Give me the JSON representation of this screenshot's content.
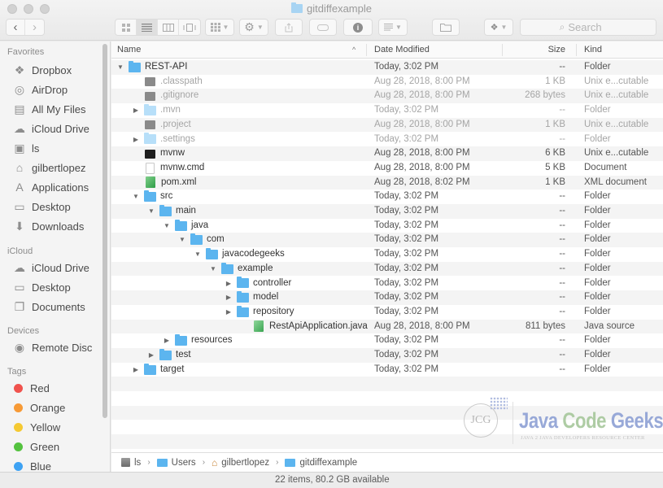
{
  "window": {
    "title": "gitdiffexample"
  },
  "toolbar": {
    "back_icon": "chevron-left-icon",
    "forward_icon": "chevron-right-icon",
    "view_modes": [
      "icon-view",
      "list-view",
      "column-view",
      "cover-flow-view"
    ],
    "active_view": "list-view",
    "search_placeholder": "Search"
  },
  "sidebar": {
    "sections": [
      {
        "heading": "Favorites",
        "items": [
          {
            "label": "Dropbox",
            "icon": "dropbox-icon"
          },
          {
            "label": "AirDrop",
            "icon": "airdrop-icon"
          },
          {
            "label": "All My Files",
            "icon": "all-files-icon"
          },
          {
            "label": "iCloud Drive",
            "icon": "cloud-icon"
          },
          {
            "label": "ls",
            "icon": "disk-icon"
          },
          {
            "label": "gilbertlopez",
            "icon": "home-icon"
          },
          {
            "label": "Applications",
            "icon": "applications-icon"
          },
          {
            "label": "Desktop",
            "icon": "desktop-icon"
          },
          {
            "label": "Downloads",
            "icon": "downloads-icon"
          }
        ]
      },
      {
        "heading": "iCloud",
        "items": [
          {
            "label": "iCloud Drive",
            "icon": "cloud-icon"
          },
          {
            "label": "Desktop",
            "icon": "desktop-icon"
          },
          {
            "label": "Documents",
            "icon": "documents-icon"
          }
        ]
      },
      {
        "heading": "Devices",
        "items": [
          {
            "label": "Remote Disc",
            "icon": "disc-icon"
          }
        ]
      },
      {
        "heading": "Tags",
        "items": [
          {
            "label": "Red",
            "color": "#f0524d"
          },
          {
            "label": "Orange",
            "color": "#f79a36"
          },
          {
            "label": "Yellow",
            "color": "#f5c932"
          },
          {
            "label": "Green",
            "color": "#54c23f"
          },
          {
            "label": "Blue",
            "color": "#3ea2f3"
          }
        ]
      }
    ]
  },
  "columns": {
    "name": "Name",
    "date": "Date Modified",
    "size": "Size",
    "kind": "Kind",
    "sort_indicator": "^"
  },
  "files": [
    {
      "name": "REST-API",
      "depth": 0,
      "disclosure": "expanded",
      "icon": "folder",
      "date": "Today, 3:02 PM",
      "size": "--",
      "kind": "Folder",
      "dim": false
    },
    {
      "name": ".classpath",
      "depth": 1,
      "disclosure": "none",
      "icon": "exec",
      "date": "Aug 28, 2018, 8:00 PM",
      "size": "1 KB",
      "kind": "Unix e...cutable",
      "dim": true
    },
    {
      "name": ".gitignore",
      "depth": 1,
      "disclosure": "none",
      "icon": "exec",
      "date": "Aug 28, 2018, 8:00 PM",
      "size": "268 bytes",
      "kind": "Unix e...cutable",
      "dim": true
    },
    {
      "name": ".mvn",
      "depth": 1,
      "disclosure": "collapsed",
      "icon": "folder-light",
      "date": "Today, 3:02 PM",
      "size": "--",
      "kind": "Folder",
      "dim": true
    },
    {
      "name": ".project",
      "depth": 1,
      "disclosure": "none",
      "icon": "exec",
      "date": "Aug 28, 2018, 8:00 PM",
      "size": "1 KB",
      "kind": "Unix e...cutable",
      "dim": true
    },
    {
      "name": ".settings",
      "depth": 1,
      "disclosure": "collapsed",
      "icon": "folder-light",
      "date": "Today, 3:02 PM",
      "size": "--",
      "kind": "Folder",
      "dim": true
    },
    {
      "name": "mvnw",
      "depth": 1,
      "disclosure": "none",
      "icon": "term",
      "date": "Aug 28, 2018, 8:00 PM",
      "size": "6 KB",
      "kind": "Unix e...cutable",
      "dim": false
    },
    {
      "name": "mvnw.cmd",
      "depth": 1,
      "disclosure": "none",
      "icon": "doc",
      "date": "Aug 28, 2018, 8:00 PM",
      "size": "5 KB",
      "kind": "Document",
      "dim": false
    },
    {
      "name": "pom.xml",
      "depth": 1,
      "disclosure": "none",
      "icon": "xml",
      "date": "Aug 28, 2018, 8:02 PM",
      "size": "1 KB",
      "kind": "XML document",
      "dim": false
    },
    {
      "name": "src",
      "depth": 1,
      "disclosure": "expanded",
      "icon": "folder",
      "date": "Today, 3:02 PM",
      "size": "--",
      "kind": "Folder",
      "dim": false
    },
    {
      "name": "main",
      "depth": 2,
      "disclosure": "expanded",
      "icon": "folder",
      "date": "Today, 3:02 PM",
      "size": "--",
      "kind": "Folder",
      "dim": false
    },
    {
      "name": "java",
      "depth": 3,
      "disclosure": "expanded",
      "icon": "folder",
      "date": "Today, 3:02 PM",
      "size": "--",
      "kind": "Folder",
      "dim": false
    },
    {
      "name": "com",
      "depth": 4,
      "disclosure": "expanded",
      "icon": "folder",
      "date": "Today, 3:02 PM",
      "size": "--",
      "kind": "Folder",
      "dim": false
    },
    {
      "name": "javacodegeeks",
      "depth": 5,
      "disclosure": "expanded",
      "icon": "folder",
      "date": "Today, 3:02 PM",
      "size": "--",
      "kind": "Folder",
      "dim": false
    },
    {
      "name": "example",
      "depth": 6,
      "disclosure": "expanded",
      "icon": "folder",
      "date": "Today, 3:02 PM",
      "size": "--",
      "kind": "Folder",
      "dim": false
    },
    {
      "name": "controller",
      "depth": 7,
      "disclosure": "collapsed",
      "icon": "folder",
      "date": "Today, 3:02 PM",
      "size": "--",
      "kind": "Folder",
      "dim": false
    },
    {
      "name": "model",
      "depth": 7,
      "disclosure": "collapsed",
      "icon": "folder",
      "date": "Today, 3:02 PM",
      "size": "--",
      "kind": "Folder",
      "dim": false
    },
    {
      "name": "repository",
      "depth": 7,
      "disclosure": "collapsed",
      "icon": "folder",
      "date": "Today, 3:02 PM",
      "size": "--",
      "kind": "Folder",
      "dim": false
    },
    {
      "name": "RestApiApplication.java",
      "depth": 8,
      "disclosure": "none",
      "icon": "java",
      "date": "Aug 28, 2018, 8:00 PM",
      "size": "811 bytes",
      "kind": "Java source",
      "dim": false
    },
    {
      "name": "resources",
      "depth": 3,
      "disclosure": "collapsed",
      "icon": "folder",
      "date": "Today, 3:02 PM",
      "size": "--",
      "kind": "Folder",
      "dim": false
    },
    {
      "name": "test",
      "depth": 2,
      "disclosure": "collapsed",
      "icon": "folder",
      "date": "Today, 3:02 PM",
      "size": "--",
      "kind": "Folder",
      "dim": false
    },
    {
      "name": "target",
      "depth": 1,
      "disclosure": "collapsed",
      "icon": "folder",
      "date": "Today, 3:02 PM",
      "size": "--",
      "kind": "Folder",
      "dim": false
    }
  ],
  "pathbar": [
    {
      "label": "ls",
      "icon": "disk-icon"
    },
    {
      "label": "Users",
      "icon": "folder-icon"
    },
    {
      "label": "gilbertlopez",
      "icon": "home-icon"
    },
    {
      "label": "gitdiffexample",
      "icon": "folder-icon"
    }
  ],
  "status": {
    "text": "22 items, 80.2 GB available"
  },
  "watermark": {
    "badge": "JCG",
    "title_java": "Java",
    "title_code": "Code",
    "title_geeks": "Geeks",
    "subtitle": "JAVA 2 JAVA DEVELOPERS RESOURCE CENTER"
  }
}
